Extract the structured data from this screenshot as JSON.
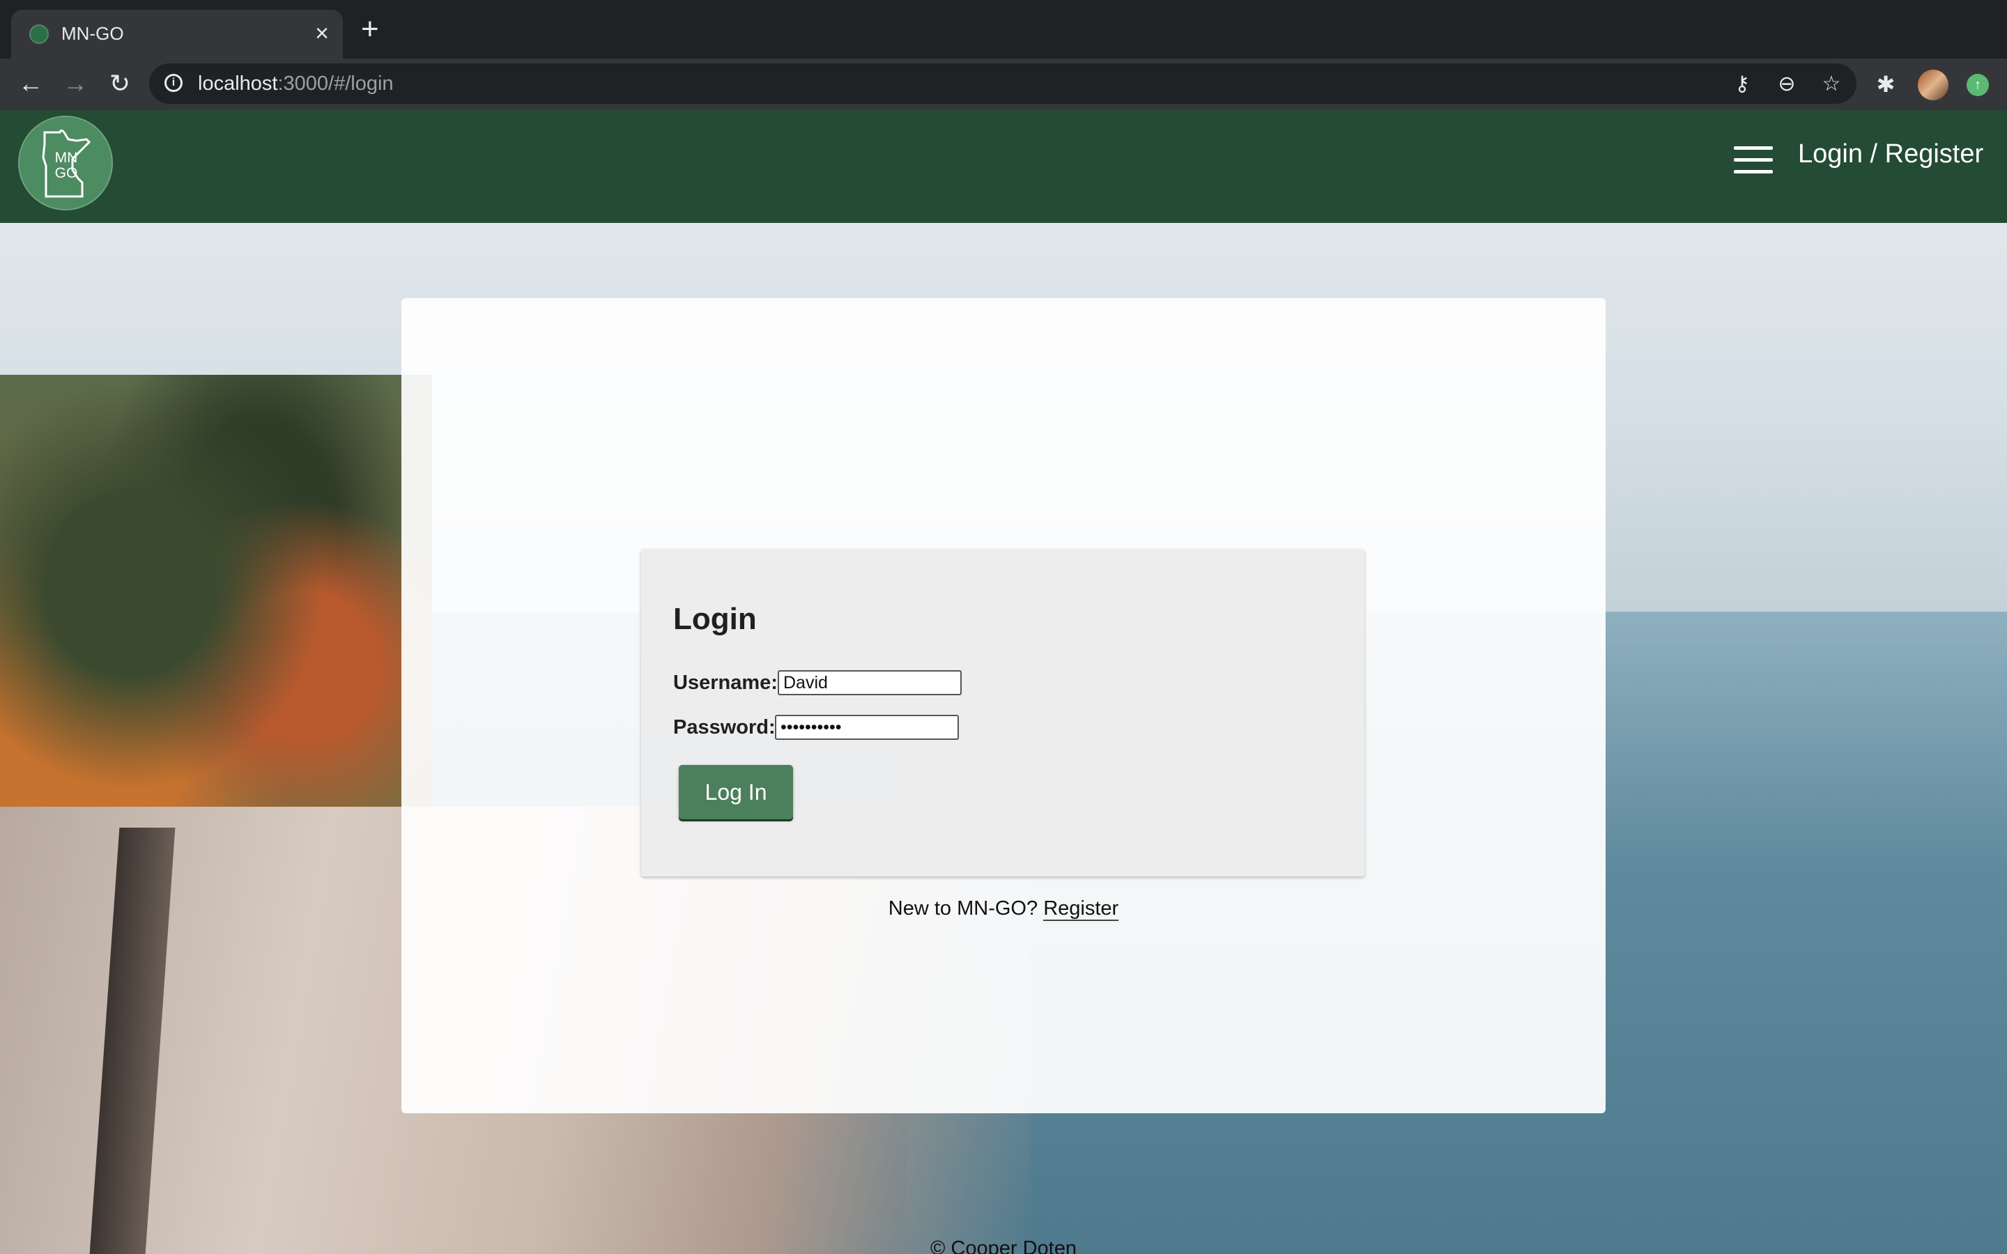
{
  "browser": {
    "tab_title": "MN-GO",
    "url_host": "localhost",
    "url_rest": ":3000/#/login",
    "icons": [
      "back-arrow-icon",
      "forward-arrow-icon",
      "reload-icon",
      "info-icon",
      "key-icon",
      "zoom-out-icon",
      "star-icon",
      "extensions-icon",
      "profile-avatar",
      "update-icon"
    ]
  },
  "header": {
    "logo_text_line1": "MN",
    "logo_text_line2": "GO",
    "nav_link": "Login / Register",
    "color": "#244b34"
  },
  "login": {
    "title": "Login",
    "username_label": "Username:",
    "username_value": "David",
    "password_label": "Password:",
    "password_value": "••••••••••",
    "submit_label": "Log In",
    "button_color": "#4c7f5c"
  },
  "register": {
    "prompt": "New to MN-GO?",
    "link": "Register"
  },
  "footer": {
    "text": "© Cooper Doten"
  }
}
